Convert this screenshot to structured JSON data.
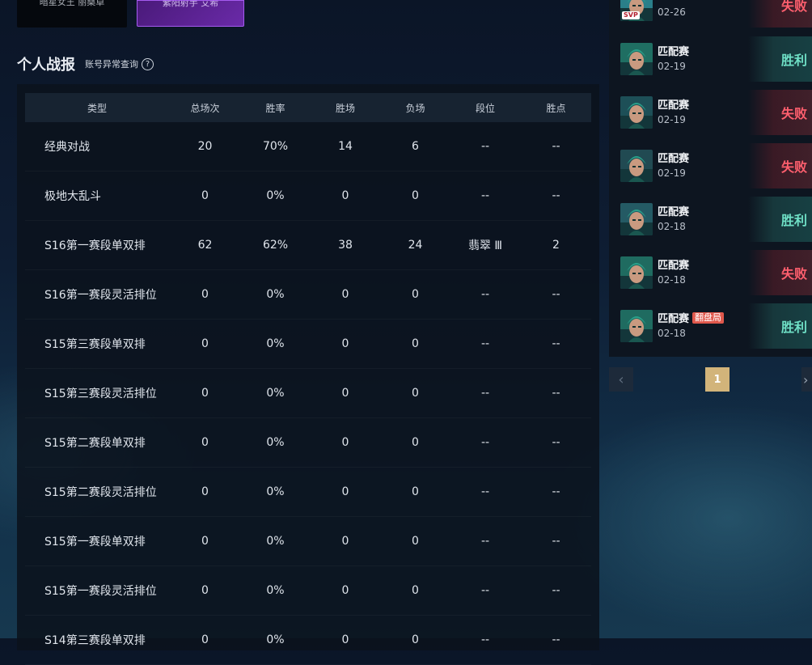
{
  "top_cards": [
    "暗星女王 丽桑卓",
    "紫阳射手 艾希"
  ],
  "section": {
    "title": "个人战报",
    "link": "账号异常查询",
    "help_glyph": "?"
  },
  "table": {
    "headers": [
      "类型",
      "总场次",
      "胜率",
      "胜场",
      "负场",
      "段位",
      "胜点"
    ],
    "rows": [
      [
        "经典对战",
        "20",
        "70%",
        "14",
        "6",
        "--",
        "--"
      ],
      [
        "极地大乱斗",
        "0",
        "0%",
        "0",
        "0",
        "--",
        "--"
      ],
      [
        "S16第一赛段单双排",
        "62",
        "62%",
        "38",
        "24",
        "翡翠 Ⅲ",
        "2"
      ],
      [
        "S16第一赛段灵活排位",
        "0",
        "0%",
        "0",
        "0",
        "--",
        "--"
      ],
      [
        "S15第三赛段单双排",
        "0",
        "0%",
        "0",
        "0",
        "--",
        "--"
      ],
      [
        "S15第三赛段灵活排位",
        "0",
        "0%",
        "0",
        "0",
        "--",
        "--"
      ],
      [
        "S15第二赛段单双排",
        "0",
        "0%",
        "0",
        "0",
        "--",
        "--"
      ],
      [
        "S15第二赛段灵活排位",
        "0",
        "0%",
        "0",
        "0",
        "--",
        "--"
      ],
      [
        "S15第一赛段单双排",
        "0",
        "0%",
        "0",
        "0",
        "--",
        "--"
      ],
      [
        "S15第一赛段灵活排位",
        "0",
        "0%",
        "0",
        "0",
        "--",
        "--"
      ],
      [
        "S14第三赛段单双排",
        "0",
        "0%",
        "0",
        "0",
        "--",
        "--"
      ]
    ]
  },
  "matches": [
    {
      "name": "",
      "date": "02-26",
      "result": "失败",
      "tag": "",
      "badge": "SVP",
      "win": false
    },
    {
      "name": "匹配赛",
      "date": "02-19",
      "result": "胜利",
      "tag": "",
      "badge": "",
      "win": true
    },
    {
      "name": "匹配赛",
      "date": "02-19",
      "result": "失败",
      "tag": "",
      "badge": "",
      "win": false
    },
    {
      "name": "匹配赛",
      "date": "02-19",
      "result": "失败",
      "tag": "",
      "badge": "",
      "win": false
    },
    {
      "name": "匹配赛",
      "date": "02-18",
      "result": "胜利",
      "tag": "",
      "badge": "",
      "win": true
    },
    {
      "name": "匹配赛",
      "date": "02-18",
      "result": "失败",
      "tag": "",
      "badge": "",
      "win": false
    },
    {
      "name": "匹配赛",
      "date": "02-18",
      "result": "胜利",
      "tag": "翻盘局",
      "badge": "",
      "win": true
    }
  ],
  "pager": {
    "prev": "‹",
    "current": "1",
    "next": "›"
  },
  "colors": {
    "win": "#6fe0c6",
    "loss": "#ff5f6e",
    "accent_gold": "#d2b47a",
    "tag_red": "#e0584c"
  }
}
